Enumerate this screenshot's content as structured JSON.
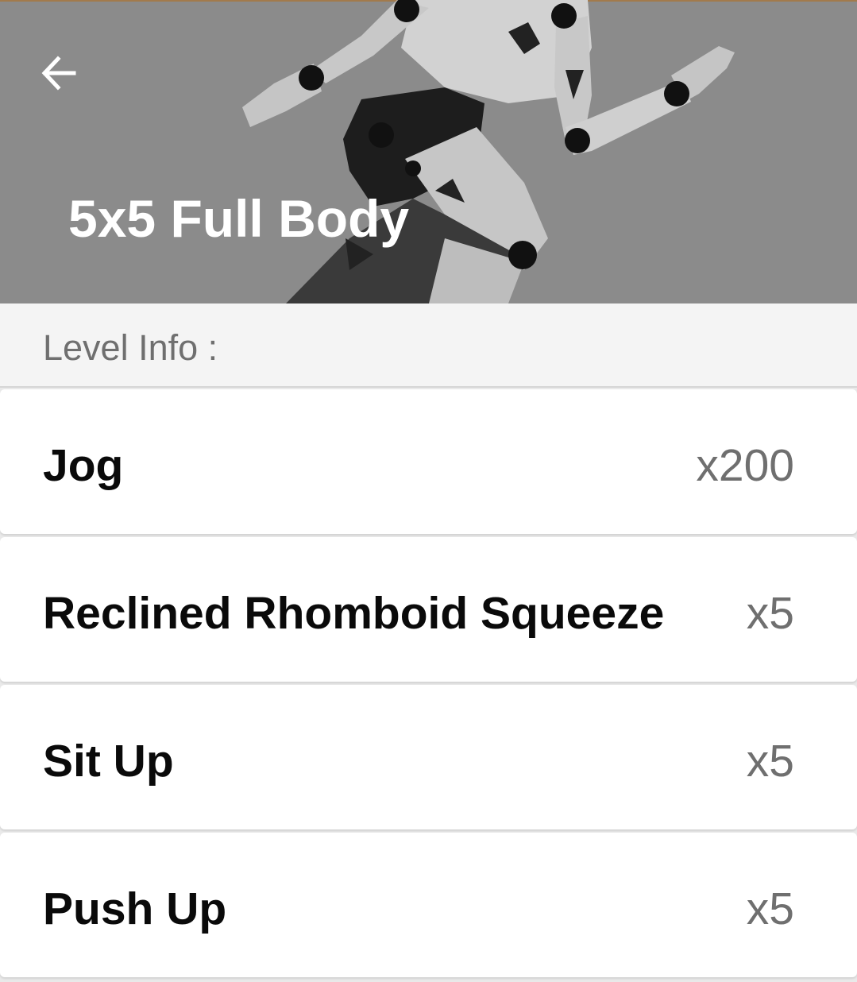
{
  "header": {
    "title": "5x5 Full Body",
    "back_icon": "arrow-left-icon",
    "hero_image": "running-figure-illustration"
  },
  "level_info": {
    "label": "Level Info :"
  },
  "exercises": [
    {
      "name": "Jog",
      "reps": "x200"
    },
    {
      "name": "Reclined Rhomboid Squeeze",
      "reps": "x5"
    },
    {
      "name": "Sit Up",
      "reps": "x5"
    },
    {
      "name": "Push Up",
      "reps": "x5"
    }
  ],
  "colors": {
    "hero_bg": "#8b8b8b",
    "level_bar_bg": "#f4f4f4",
    "row_bg": "#ffffff",
    "rep_text": "#6f6f6f"
  }
}
